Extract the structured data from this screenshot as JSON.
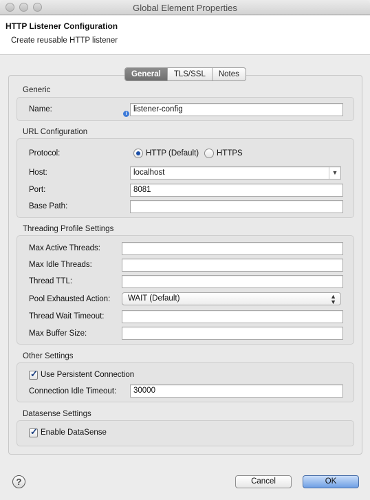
{
  "window": {
    "title": "Global Element Properties"
  },
  "header": {
    "title": "HTTP Listener Configuration",
    "subtitle": "Create reusable HTTP listener"
  },
  "tabs": [
    {
      "label": "General",
      "active": true
    },
    {
      "label": "TLS/SSL",
      "active": false
    },
    {
      "label": "Notes",
      "active": false
    }
  ],
  "generic": {
    "section": "Generic",
    "name_label": "Name:",
    "name_value": "listener-config"
  },
  "url": {
    "section": "URL Configuration",
    "protocol_label": "Protocol:",
    "http_option": "HTTP (Default)",
    "https_option": "HTTPS",
    "selected_protocol": "HTTP (Default)",
    "host_label": "Host:",
    "host_value": "localhost",
    "port_label": "Port:",
    "port_value": "8081",
    "base_path_label": "Base Path:",
    "base_path_value": ""
  },
  "threading": {
    "section": "Threading Profile Settings",
    "max_active_label": "Max Active Threads:",
    "max_idle_label": "Max Idle Threads:",
    "ttl_label": "Thread TTL:",
    "pool_label": "Pool Exhausted Action:",
    "pool_value": "WAIT (Default)",
    "wait_timeout_label": "Thread Wait Timeout:",
    "max_buffer_label": "Max Buffer Size:"
  },
  "other": {
    "section": "Other Settings",
    "persistent_label": "Use Persistent Connection",
    "persistent_checked": true,
    "idle_timeout_label": "Connection Idle Timeout:",
    "idle_timeout_value": "30000"
  },
  "datasense": {
    "section": "Datasense Settings",
    "enable_label": "Enable DataSense",
    "enable_checked": true
  },
  "footer": {
    "help_icon": "?",
    "cancel_label": "Cancel",
    "ok_label": "OK"
  },
  "colors": {
    "ok_button": "#6e9fe4",
    "active_tab": "#7a7a7a",
    "radio_dot": "#1b4fa8"
  }
}
